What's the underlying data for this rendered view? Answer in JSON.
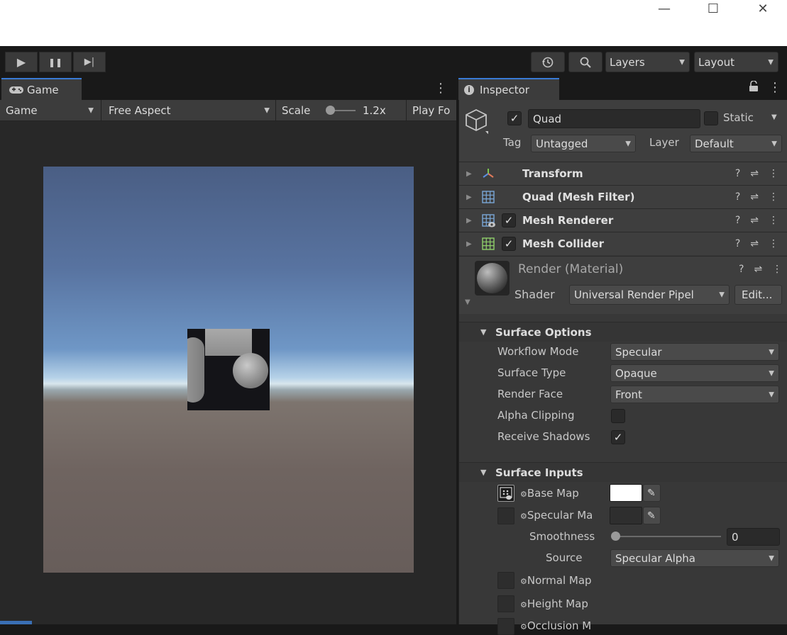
{
  "window": {
    "minimize": "—",
    "maximize": "☐",
    "close": "✕"
  },
  "toolbar": {
    "play": "▶",
    "pause": "❚❚",
    "step": "▶|",
    "layers_label": "Layers",
    "layout_label": "Layout"
  },
  "game_panel": {
    "tab_label": "Game",
    "display_label": "Game",
    "aspect_label": "Free Aspect",
    "scale_label": "Scale",
    "scale_value": "1.2x",
    "scale_fraction": 0.0,
    "play_focused_label": "Play Fo"
  },
  "inspector": {
    "tab_label": "Inspector",
    "object": {
      "name": "Quad",
      "active": true,
      "static_label": "Static",
      "static": false,
      "tag_label": "Tag",
      "tag_value": "Untagged",
      "layer_label": "Layer",
      "layer_value": "Default"
    },
    "components": [
      {
        "label": "Transform",
        "icon": "transform-icon",
        "has_toggle": false
      },
      {
        "label": "Quad (Mesh Filter)",
        "icon": "mesh-filter-icon",
        "has_toggle": false
      },
      {
        "label": "Mesh Renderer",
        "icon": "mesh-renderer-icon",
        "has_toggle": true,
        "enabled": true
      },
      {
        "label": "Mesh Collider",
        "icon": "mesh-collider-icon",
        "has_toggle": true,
        "enabled": true
      }
    ],
    "material": {
      "name": "Render (Material)",
      "shader_label": "Shader",
      "shader_value": "Universal Render Pipel",
      "edit_label": "Edit..."
    },
    "surface_options": {
      "title": "Surface Options",
      "workflow_mode_label": "Workflow Mode",
      "workflow_mode_value": "Specular",
      "surface_type_label": "Surface Type",
      "surface_type_value": "Opaque",
      "render_face_label": "Render Face",
      "render_face_value": "Front",
      "alpha_clipping_label": "Alpha Clipping",
      "alpha_clipping": false,
      "receive_shadows_label": "Receive Shadows",
      "receive_shadows": true
    },
    "surface_inputs": {
      "title": "Surface Inputs",
      "base_map_label": "Base Map",
      "base_map_color": "#ffffff",
      "specular_map_label": "Specular Ma",
      "specular_map_color": "#2e2e2e",
      "smoothness_label": "Smoothness",
      "smoothness_value": "0",
      "source_label": "Source",
      "source_value": "Specular Alpha",
      "normal_map_label": "Normal Map",
      "height_map_label": "Height Map",
      "occlusion_map_label": "Occlusion M"
    }
  },
  "icons": {
    "question": "?",
    "sliders": "⇌",
    "kebab": "⋮",
    "lock": "🔓",
    "caret": "▼",
    "fold_closed": "▶",
    "fold_open": "▼",
    "check": "✓",
    "picker": "✎"
  }
}
